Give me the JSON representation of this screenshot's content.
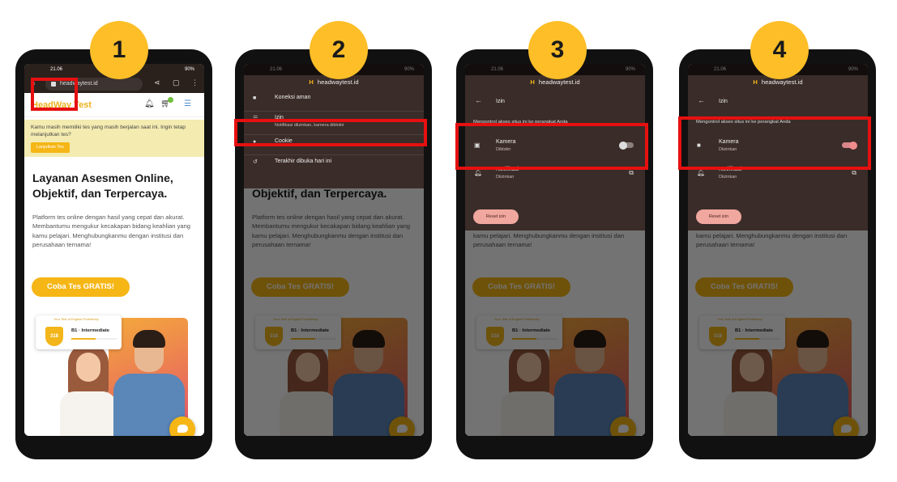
{
  "steps": [
    "1",
    "2",
    "3",
    "4"
  ],
  "status": {
    "time": "21.06",
    "battery": "90%"
  },
  "browser": {
    "domain": "headwaytest.id"
  },
  "site": {
    "logo": "HeadWay Test",
    "banner_text": "Kamu masih memiliki tes yang masih berjalan saat ini. Ingin tetap melanjutkan tes?",
    "banner_button": "Lanjutkan Tes",
    "headline": "Layanan Asesmen Online, Objektif, dan Terpercaya.",
    "paragraph": "Platform tes online dengan hasil yang cepat dan akurat. Membantumu mengukur kecakapan bidang keahlian yang kamu pelajari. Menghubungkanmu dengan institusi dan perusahaan ternama!",
    "cta": "Coba Tes GRATIS!",
    "card_title": "Your Test of English Proficiency",
    "score": "318",
    "level": "B1 · Intermediate"
  },
  "site_menu": {
    "items": [
      {
        "label": "Koneksi aman",
        "sub": ""
      },
      {
        "label": "Izin",
        "sub": "Notifikasi diizinkan, kamera diblokir"
      },
      {
        "label": "Cookie",
        "sub": ""
      },
      {
        "label": "Terakhir dibuka hari ini",
        "sub": ""
      }
    ]
  },
  "permissions": {
    "title": "Izin",
    "control_text": "Mengontrol akses situs ini ke perangkat Anda",
    "camera_label": "Kamera",
    "camera_blocked": "Diblokir",
    "camera_allowed": "Diizinkan",
    "notif_label": "Notifikasi",
    "notif_status": "Diizinkan",
    "reset": "Reset izin"
  },
  "colors": {
    "accent": "#F5B616",
    "highlight": "#E61010"
  }
}
